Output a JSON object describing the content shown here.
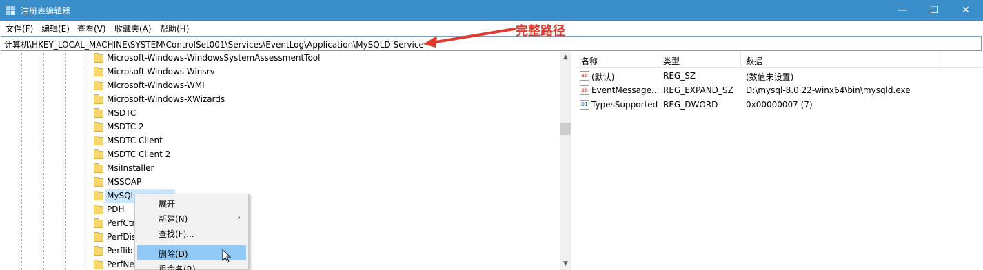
{
  "window": {
    "title": "注册表编辑器",
    "minimize_glyph": "—",
    "maximize_glyph": "☐",
    "close_glyph": "✕"
  },
  "menu": [
    "文件(F)",
    "编辑(E)",
    "查看(V)",
    "收藏夹(A)",
    "帮助(H)"
  ],
  "address": "计算机\\HKEY_LOCAL_MACHINE\\SYSTEM\\ControlSet001\\Services\\EventLog\\Application\\MySQLD Service",
  "annotation": {
    "text": "完整路径",
    "color": "#e03a2f"
  },
  "tree": {
    "items": [
      "Microsoft-Windows-WindowsSystemAssessmentTool",
      "Microsoft-Windows-Winsrv",
      "Microsoft-Windows-WMI",
      "Microsoft-Windows-XWizards",
      "MSDTC",
      "MSDTC 2",
      "MSDTC Client",
      "MSDTC Client 2",
      "MsiInstaller",
      "MSSOAP",
      "MySQL",
      "PDH",
      "PerfCtr",
      "PerfDis",
      "Perflib",
      "PerfNe"
    ],
    "selected": "MySQL"
  },
  "values_list": {
    "headers": {
      "name": "名称",
      "type": "类型",
      "data": "数据"
    },
    "rows": [
      {
        "icon": "string-value-icon",
        "name": "(默认)",
        "type": "REG_SZ",
        "data": "(数值未设置)"
      },
      {
        "icon": "string-value-icon",
        "name": "EventMessage...",
        "type": "REG_EXPAND_SZ",
        "data": "D:\\mysql-8.0.22-winx64\\bin\\mysqld.exe"
      },
      {
        "icon": "dword-value-icon",
        "name": "TypesSupported",
        "type": "REG_DWORD",
        "data": "0x00000007 (7)"
      }
    ]
  },
  "context_menu": {
    "items": [
      {
        "label": "展开",
        "type": "header"
      },
      {
        "label": "新建(N)",
        "type": "submenu"
      },
      {
        "label": "查找(F)...",
        "type": "item"
      },
      {
        "label": "删除(D)",
        "type": "item",
        "hover": true
      },
      {
        "label": "重命名(R)",
        "type": "item"
      }
    ]
  },
  "colors": {
    "titlebar": "#3a8fca",
    "hover": "#91c9f7",
    "selection": "#cce8ff",
    "folder": "#f5d76e"
  }
}
